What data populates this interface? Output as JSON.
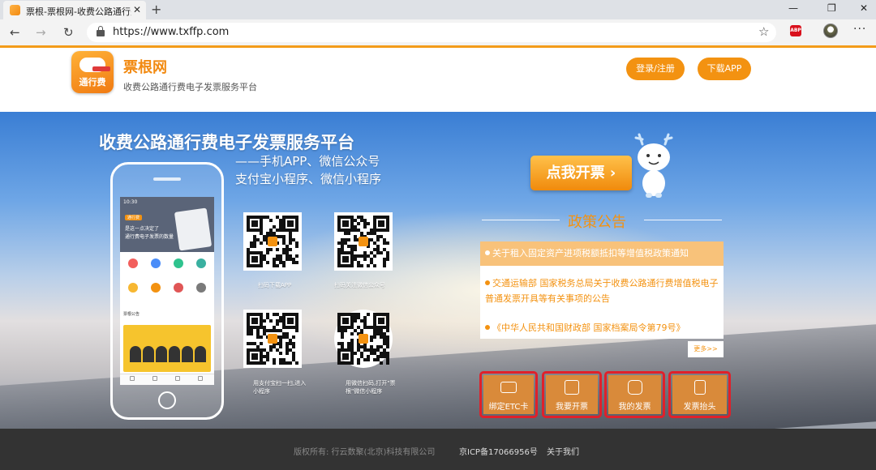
{
  "browser": {
    "tab_title": "票根-票根网-收费公路通行费增值",
    "tab_close": "✕",
    "new_tab": "+",
    "url": "https://www.txffp.com",
    "abp_label": "ABP",
    "controls": [
      "—",
      "❐",
      "✕"
    ]
  },
  "header": {
    "logo_text": "通行费",
    "brand_name": "票根网",
    "brand_sub": "收费公路通行费电子发票服务平台",
    "login_label": "登录/注册",
    "download_label": "下载APP"
  },
  "banner": {
    "headline": "收费公路通行费电子发票服务平台",
    "subline1": "——手机APP、微信公众号",
    "subline2": "支付宝小程序、微信小程序",
    "cta_label": "点我开票 ›",
    "qr_captions": {
      "app": "扫码下载APP",
      "wechat_account": "扫码关注微信公众号",
      "alipay": "用支付宝扫一扫,进入小程序",
      "wechat_mini": "用微信扫码,打开\"票根\"微信小程序"
    },
    "phone": {
      "time": "10:30",
      "badge": "通行费",
      "line1": "是这一点决定了",
      "line2": "通行费电子发票的数量",
      "bar_text": "票根公告"
    }
  },
  "policy": {
    "title": "政策公告",
    "items": [
      "关于租入固定资产进项税额抵扣等增值税政策通知",
      "交通运输部 国家税务总局关于收费公路通行费增值税电子普通发票开具等有关事项的公告",
      "《中华人民共和国财政部 国家档案局令第79号》"
    ],
    "more": "更多>>"
  },
  "tiles": [
    "绑定ETC卡",
    "我要开票",
    "我的发票",
    "发票抬头"
  ],
  "footer": {
    "copyright": "版权所有: 行云数聚(北京)科技有限公司",
    "icp": "京ICP备17066956号",
    "about": "关于我们"
  },
  "colors": {
    "accent": "#f39211",
    "footer_bg": "#333333",
    "tile_border": "#e0202a"
  }
}
